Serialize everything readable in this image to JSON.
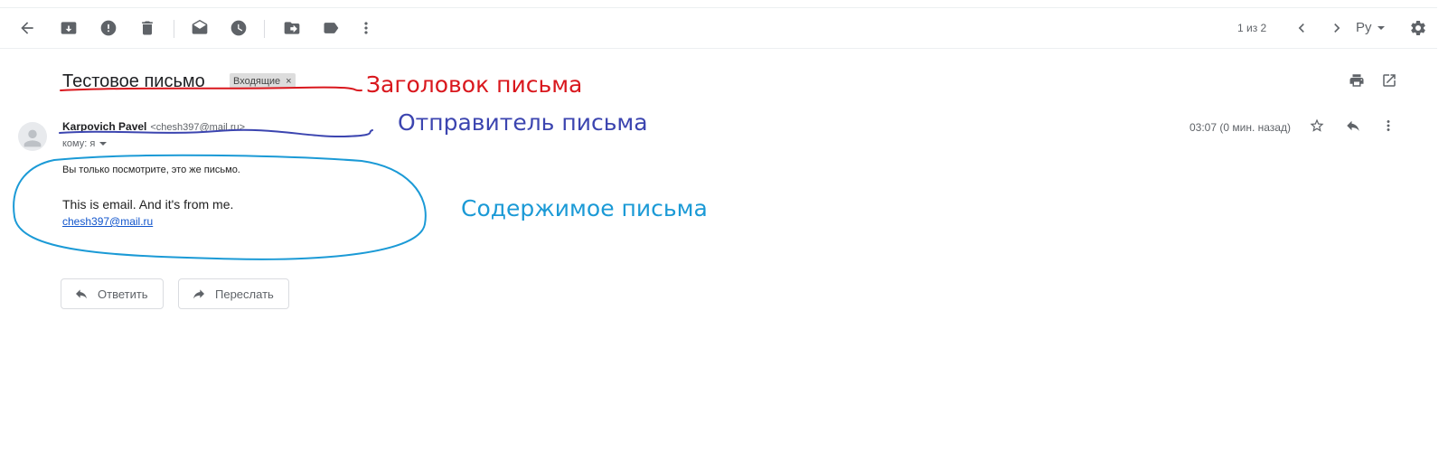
{
  "toolbar": {
    "pager_text": "1 из 2",
    "lang": "Ру",
    "icons": [
      "back-arrow-icon",
      "archive-icon",
      "report-spam-icon",
      "delete-icon",
      "mark-unread-icon",
      "snooze-icon",
      "move-to-icon",
      "label-icon",
      "more-vert-icon",
      "chevron-left-icon",
      "chevron-right-icon",
      "settings-gear-icon"
    ]
  },
  "message": {
    "subject": "Тестовое письмо",
    "label_chip": "Входящие",
    "label_close": "×",
    "sender_name": "Karpovich Pavel",
    "sender_email": "<chesh397@mail.ru>",
    "to_line": "кому: я",
    "time": "03:07 (0 мин. назад)",
    "body_line1": "Вы только посмотрите, это же письмо.",
    "body_line2": "This is email. And it's from me.",
    "body_link": "chesh397@mail.ru"
  },
  "actions": {
    "reply": "Ответить",
    "forward": "Переслать"
  },
  "annotations": {
    "subject_note": "Заголовок письма",
    "sender_note": "Отправитель письма",
    "content_note": "Содержимое письма",
    "colors": {
      "subject": "#d9171d",
      "sender": "#3c45b0",
      "content": "#1b9ad6"
    }
  }
}
